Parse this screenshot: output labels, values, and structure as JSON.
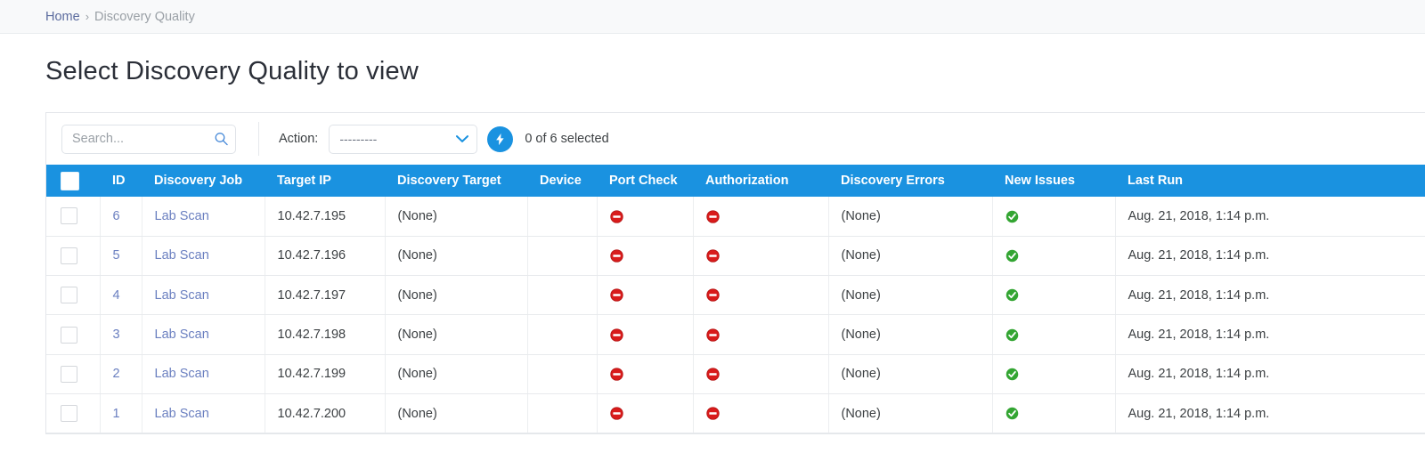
{
  "breadcrumb": {
    "home": "Home",
    "separator": "›",
    "current": "Discovery Quality"
  },
  "page": {
    "title": "Select Discovery Quality to view"
  },
  "toolbar": {
    "search_placeholder": "Search...",
    "search_value": "",
    "search_icon": "search-icon",
    "action_label": "Action:",
    "action_selected": "---------",
    "action_options": [
      "---------"
    ],
    "go_icon": "lightning-bolt-icon",
    "go_color": "#1a92e0",
    "selected_count": "0 of 6 selected"
  },
  "table": {
    "header_color": "#1a92e0",
    "columns": [
      "ID",
      "Discovery Job",
      "Target IP",
      "Discovery Target",
      "Device",
      "Port Check",
      "Authorization",
      "Discovery Errors",
      "New Issues",
      "Last Run"
    ],
    "status_colors": {
      "deny": "#d91b1b",
      "ok": "#33a532"
    },
    "rows": [
      {
        "id": "6",
        "discovery_job": "Lab Scan",
        "target_ip": "10.42.7.195",
        "discovery_target": "(None)",
        "device": "",
        "port_check": "deny-icon",
        "authorization": "deny-icon",
        "discovery_errors": "(None)",
        "new_issues": "ok-icon",
        "last_run": "Aug. 21, 2018, 1:14 p.m."
      },
      {
        "id": "5",
        "discovery_job": "Lab Scan",
        "target_ip": "10.42.7.196",
        "discovery_target": "(None)",
        "device": "",
        "port_check": "deny-icon",
        "authorization": "deny-icon",
        "discovery_errors": "(None)",
        "new_issues": "ok-icon",
        "last_run": "Aug. 21, 2018, 1:14 p.m."
      },
      {
        "id": "4",
        "discovery_job": "Lab Scan",
        "target_ip": "10.42.7.197",
        "discovery_target": "(None)",
        "device": "",
        "port_check": "deny-icon",
        "authorization": "deny-icon",
        "discovery_errors": "(None)",
        "new_issues": "ok-icon",
        "last_run": "Aug. 21, 2018, 1:14 p.m."
      },
      {
        "id": "3",
        "discovery_job": "Lab Scan",
        "target_ip": "10.42.7.198",
        "discovery_target": "(None)",
        "device": "",
        "port_check": "deny-icon",
        "authorization": "deny-icon",
        "discovery_errors": "(None)",
        "new_issues": "ok-icon",
        "last_run": "Aug. 21, 2018, 1:14 p.m."
      },
      {
        "id": "2",
        "discovery_job": "Lab Scan",
        "target_ip": "10.42.7.199",
        "discovery_target": "(None)",
        "device": "",
        "port_check": "deny-icon",
        "authorization": "deny-icon",
        "discovery_errors": "(None)",
        "new_issues": "ok-icon",
        "last_run": "Aug. 21, 2018, 1:14 p.m."
      },
      {
        "id": "1",
        "discovery_job": "Lab Scan",
        "target_ip": "10.42.7.200",
        "discovery_target": "(None)",
        "device": "",
        "port_check": "deny-icon",
        "authorization": "deny-icon",
        "discovery_errors": "(None)",
        "new_issues": "ok-icon",
        "last_run": "Aug. 21, 2018, 1:14 p.m."
      }
    ]
  }
}
